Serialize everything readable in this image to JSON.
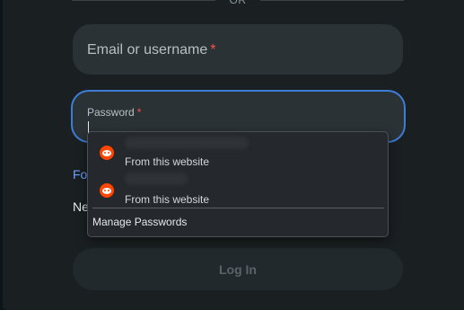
{
  "login_form": {
    "divider_text": "OR",
    "email_label": "Email or username",
    "password_label": "Password",
    "required_mark": "*",
    "forgot_text": "Fo",
    "new_text": "Ne",
    "login_button": "Log In"
  },
  "autofill_popup": {
    "entries": [
      {
        "source": "From this website",
        "icon": "reddit-icon"
      },
      {
        "source": "From this website",
        "icon": "reddit-icon"
      }
    ],
    "manage_label": "Manage Passwords"
  },
  "colors": {
    "accent": "#3d7dd8",
    "required": "#ff4d4d",
    "brand": "#ff4500"
  }
}
